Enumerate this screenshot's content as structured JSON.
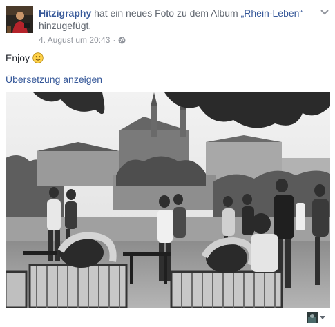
{
  "header": {
    "author": "Hitzigraphy",
    "action_text": " hat ein neues Foto zu dem Album ",
    "album": "„Rhein-Leben“",
    "action_suffix": " hinzugefügt."
  },
  "meta": {
    "timestamp": "4. August um 20:43",
    "separator": "·",
    "privacy_icon": "globe-icon"
  },
  "post": {
    "text": "Enjoy",
    "emoji": "smile-emoji"
  },
  "translate_link": "Übersetzung anzeigen",
  "icons": {
    "options": "chevron-down-icon",
    "audience": "mini-avatar"
  }
}
